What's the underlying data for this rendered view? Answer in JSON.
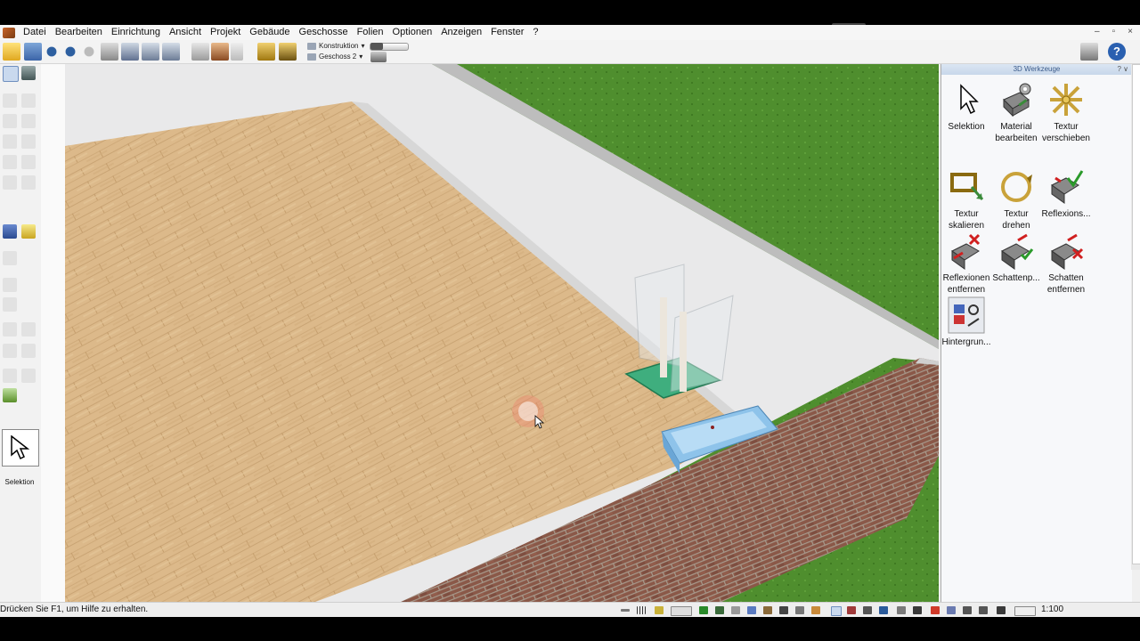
{
  "menu": {
    "items": [
      "Datei",
      "Bearbeiten",
      "Einrichtung",
      "Ansicht",
      "Projekt",
      "Gebäude",
      "Geschosse",
      "Folien",
      "Optionen",
      "Anzeigen",
      "Fenster",
      "?"
    ]
  },
  "window_controls": [
    "–",
    "▫",
    "×"
  ],
  "toolbar": {
    "layer_combo": "Konstruktion",
    "floor_combo": "Geschoss 2"
  },
  "left_strip": {
    "active_tool_label": "Selektion"
  },
  "panel": {
    "title": "3D Werkzeuge",
    "title_controls": "? ∨",
    "tools": [
      {
        "label": "Selektion",
        "icon": "cursor-icon"
      },
      {
        "label": "Material bearbeiten",
        "icon": "material-edit-icon"
      },
      {
        "label": "Textur verschieben",
        "icon": "texture-move-icon"
      },
      {
        "label": "Textur skalieren",
        "icon": "texture-scale-icon"
      },
      {
        "label": "Textur drehen",
        "icon": "texture-rotate-icon"
      },
      {
        "label": "Reflexions...",
        "icon": "reflection-icon"
      },
      {
        "label": "Reflexionen entfernen",
        "icon": "reflection-remove-icon"
      },
      {
        "label": "Schattenp...",
        "icon": "shadow-icon"
      },
      {
        "label": "Schatten entfernen",
        "icon": "shadow-remove-icon"
      },
      {
        "label": "Hintergrun...",
        "icon": "background-icon"
      }
    ]
  },
  "status": {
    "message": "Drücken Sie F1, um Hilfe zu erhalten.",
    "scale": "1:100"
  },
  "colors": {
    "grass": "#4f8e2e",
    "floor_wood": "#dcb98a",
    "wall_top": "#e9e9ea",
    "brick": "#8a5848",
    "panel_title": "#c7d7ea"
  }
}
